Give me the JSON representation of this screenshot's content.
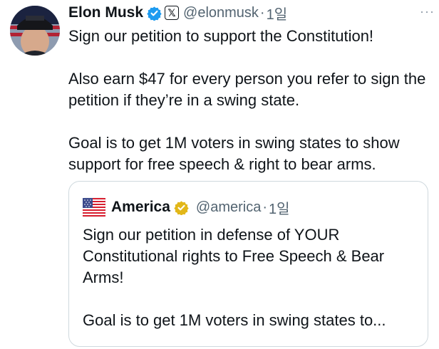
{
  "tweet": {
    "author_name": "Elon Musk",
    "author_handle": "@elonmusk",
    "separator": "·",
    "time": "1일",
    "more_label": "···",
    "paragraphs": [
      "Sign our petition to support the Constitution!",
      "Also earn $47 for every person you refer to sign the petition if they’re in a swing state.",
      "Goal is to get 1M voters in swing states to show support for free speech & right to bear arms."
    ]
  },
  "quoted": {
    "author_name": "America",
    "author_handle": "@america",
    "separator": "·",
    "time": "1일",
    "paragraphs": [
      "Sign our petition in defense of YOUR Constitutional rights to Free Speech & Bear Arms!",
      "Goal is to get 1M voters in swing states to..."
    ]
  },
  "icons": {
    "verified": "blue-checkmark-icon",
    "x_badge": "x-logo-icon",
    "gold_verified": "gold-checkmark-icon",
    "flag": "us-flag-icon",
    "more": "more-dots-icon"
  },
  "colors": {
    "text": "#0f1419",
    "secondary": "#536471",
    "border": "#cfd9de",
    "verified_blue": "#1d9bf0",
    "verified_gold": "#e2b719"
  }
}
